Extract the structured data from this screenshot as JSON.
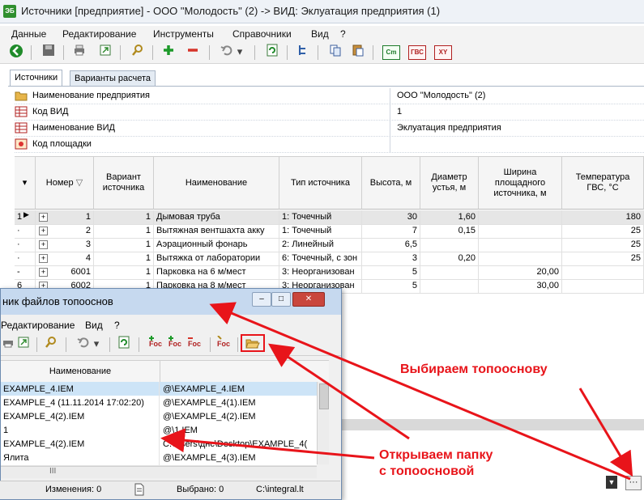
{
  "window": {
    "title": "Источники [предприятие] - ООО \"Молодость\" (2) -> ВИД: Эклуатация предприятия (1)",
    "icon_text": "ЭБ"
  },
  "menu": [
    "Данные",
    "Редактирование",
    "Инструменты",
    "Справочники",
    "Вид",
    "?"
  ],
  "toolbar_icons": [
    "back-icon",
    "save-icon",
    "print-icon",
    "export-icon",
    "search-icon",
    "add-icon",
    "remove-icon",
    "undo-icon",
    "refresh-icon",
    "tree-icon",
    "copy-icon",
    "paste-icon",
    "cm-icon",
    "gvs-icon",
    "xy-icon"
  ],
  "toolbar_labels": {
    "cm": "Cm",
    "gvs": "ГВС",
    "xy": "XY"
  },
  "tabs": [
    "Источники",
    "Варианты расчета"
  ],
  "properties": [
    {
      "label": "Наименование предприятия",
      "value": "ООО \"Молодость\" (2)",
      "icon": "folder-icon"
    },
    {
      "label": "Код ВИД",
      "value": "1",
      "icon": "table-icon"
    },
    {
      "label": "Наименование ВИД",
      "value": "Эклуатация предприятия",
      "icon": "table-icon"
    },
    {
      "label": "Код площадки",
      "value": "",
      "icon": "site-icon"
    }
  ],
  "grid": {
    "headers": [
      "Номер",
      "Вариант источника",
      "Наименование",
      "Тип источника",
      "Высота, м",
      "Диаметр устья, м",
      "Ширина площадного источника, м",
      "Температура ГВС, °С"
    ],
    "rows": [
      {
        "mark": "1",
        "num": "1",
        "var": "1",
        "name": "Дымовая труба",
        "type": "1: Точечный",
        "h": "30",
        "d": "1,60",
        "w": "",
        "t": "180"
      },
      {
        "mark": "·",
        "num": "2",
        "var": "1",
        "name": "Вытяжная вентшахта акку",
        "type": "1: Точечный",
        "h": "7",
        "d": "0,15",
        "w": "",
        "t": "25"
      },
      {
        "mark": "·",
        "num": "3",
        "var": "1",
        "name": "Аэрационный фонарь",
        "type": "2: Линейный",
        "h": "6,5",
        "d": "",
        "w": "",
        "t": "25"
      },
      {
        "mark": "·",
        "num": "4",
        "var": "1",
        "name": "Вытяжка от лаборатории",
        "type": "6: Точечный, с зон",
        "h": "3",
        "d": "0,20",
        "w": "",
        "t": "25"
      },
      {
        "mark": "-",
        "num": "6001",
        "var": "1",
        "name": "Парковка на 6 м/мест",
        "type": "3: Неорганизован",
        "h": "5",
        "d": "",
        "w": "20,00",
        "t": ""
      },
      {
        "mark": "6",
        "num": "6002",
        "var": "1",
        "name": "Парковка на 8 м/мест",
        "type": "3: Неорганизован",
        "h": "5",
        "d": "",
        "w": "30,00",
        "t": ""
      }
    ]
  },
  "dialog": {
    "title": "ник файлов топооснов",
    "menu": [
      "Редактирование",
      "Вид",
      "?"
    ],
    "column_header": "Наименование",
    "rows": [
      {
        "name": "EXAMPLE_4.IEM",
        "path": "@\\EXAMPLE_4.IEM"
      },
      {
        "name": "EXAMPLE_4 (11.11.2014 17:02:20)",
        "path": "@\\EXAMPLE_4(1).IEM"
      },
      {
        "name": "EXAMPLE_4(2).IEM",
        "path": "@\\EXAMPLE_4(2).IEM"
      },
      {
        "name": "1",
        "path": "@\\1.IEM"
      },
      {
        "name": "EXAMPLE_4(2).IEM",
        "path": "C:\\Users\\днс\\Desktop\\EXAMPLE_4("
      },
      {
        "name": "Ялита",
        "path": "@\\EXAMPLE_4(3).IEM"
      }
    ],
    "scroll_glyph": "III",
    "status": {
      "changes": "Изменения: 0",
      "selected": "Выбрано: 0",
      "path": "C:\\integral.lt"
    }
  },
  "annotations": {
    "choose": "Выбираем топооснову",
    "open_line1": "Открываем папку",
    "open_line2": "с топоосновой"
  },
  "colors": {
    "arrow": "#e8141a",
    "selected_row": "#cde4f7"
  }
}
